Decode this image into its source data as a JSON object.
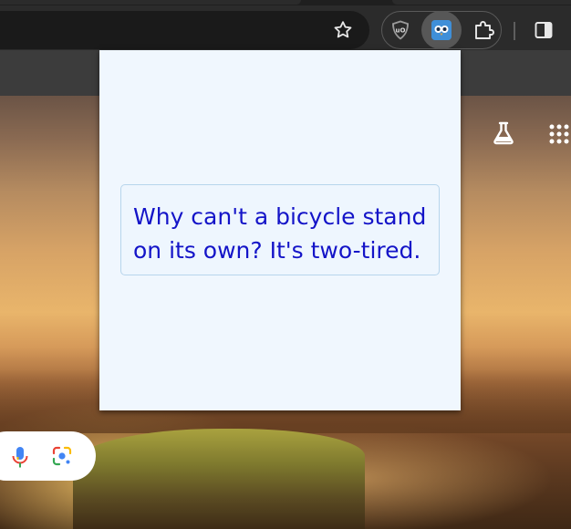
{
  "toolbar": {
    "icons": {
      "bookmark": "star-icon",
      "ublock": "ublock-origin-icon",
      "extension_active": "owl-extension-icon",
      "extensions_menu": "puzzle-icon",
      "side_panel": "side-panel-icon"
    }
  },
  "new_tab": {
    "icons": {
      "labs": "flask-icon",
      "apps": "apps-grid-icon",
      "voice_search": "microphone-icon",
      "image_search": "google-lens-icon"
    }
  },
  "popup": {
    "joke_lines": [
      "Why can't a bicycle stand",
      "on its own? It's two-tired."
    ],
    "text_color": "#1414c8",
    "background_color": "#f0f7fe"
  },
  "colors": {
    "toolbar": "#2b2b2b",
    "omnibox": "#1a1a1a",
    "extension_highlight": "#575757"
  }
}
